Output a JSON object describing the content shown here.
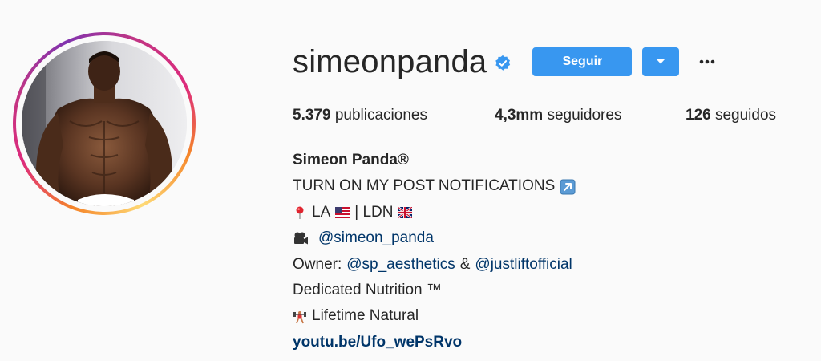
{
  "profile": {
    "username": "simeonpanda",
    "verified": true,
    "follow_label": "Seguir",
    "accent_color": "#3897f0"
  },
  "stats": {
    "posts_count": "5.379",
    "posts_label": "publicaciones",
    "followers_count": "4,3mm",
    "followers_label": "seguidores",
    "following_count": "126",
    "following_label": "seguidos"
  },
  "bio": {
    "full_name": "Simeon Panda®",
    "line1": "TURN ON MY POST NOTIFICATIONS",
    "line1_icon": "arrow-up-right-icon",
    "line2_a": "LA",
    "line2_sep": "| LDN",
    "line2_icons": [
      "pin-icon",
      "us-flag-icon",
      "uk-flag-icon"
    ],
    "line3_mention": "@simeon_panda",
    "line3_icon": "movie-camera-icon",
    "line4_prefix": "Owner:",
    "line4_mention1": "@sp_aesthetics",
    "line4_amp": "&",
    "line4_mention2": "@justliftofficial",
    "line5": "Dedicated Nutrition ™",
    "line6": "Lifetime Natural",
    "line6_icon": "weightlifter-icon",
    "link": "youtu.be/Ufo_wePsRvo"
  }
}
